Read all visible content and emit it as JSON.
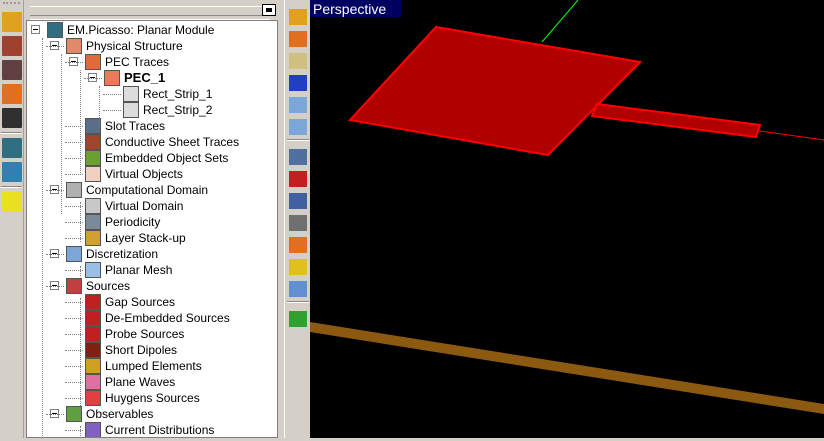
{
  "panel": {
    "maximize_label": ""
  },
  "tree": [
    {
      "label": "EM.Picasso: Planar Module",
      "level": 0,
      "expanded": true,
      "icon": "planar-module-icon",
      "color": "#2f6f7f"
    },
    {
      "label": "Physical Structure",
      "level": 1,
      "expanded": true,
      "icon": "physical-structure-icon",
      "color": "#e08a6a"
    },
    {
      "label": "PEC Traces",
      "level": 2,
      "expanded": true,
      "icon": "pec-traces-icon",
      "color": "#e06a3a"
    },
    {
      "label": "PEC_1",
      "level": 3,
      "expanded": true,
      "bold": true,
      "icon": "pec-group-icon",
      "color": "#e87a5a"
    },
    {
      "label": "Rect_Strip_1",
      "level": 4,
      "icon": "rect-strip-icon",
      "color": "#dcdcdc"
    },
    {
      "label": "Rect_Strip_2",
      "level": 4,
      "icon": "rect-strip-icon",
      "color": "#dcdcdc"
    },
    {
      "label": "Slot Traces",
      "level": 2,
      "icon": "slot-traces-icon",
      "color": "#5a6e8a"
    },
    {
      "label": "Conductive Sheet Traces",
      "level": 2,
      "icon": "conductive-sheet-icon",
      "color": "#a0442a"
    },
    {
      "label": "Embedded Object Sets",
      "level": 2,
      "icon": "embedded-objects-icon",
      "color": "#6aa030"
    },
    {
      "label": "Virtual Objects",
      "level": 2,
      "icon": "virtual-objects-icon",
      "color": "#f0d0c0"
    },
    {
      "label": "Computational Domain",
      "level": 1,
      "expanded": true,
      "icon": "computational-domain-icon",
      "color": "#b0b0b0"
    },
    {
      "label": "Virtual Domain",
      "level": 2,
      "icon": "virtual-domain-icon",
      "color": "#c8c8c8"
    },
    {
      "label": "Periodicity",
      "level": 2,
      "icon": "periodicity-icon",
      "color": "#7a8a9a"
    },
    {
      "label": "Layer Stack-up",
      "level": 2,
      "icon": "layer-stackup-icon",
      "color": "#d0a030"
    },
    {
      "label": "Discretization",
      "level": 1,
      "expanded": true,
      "icon": "discretization-icon",
      "color": "#7aa6d8"
    },
    {
      "label": "Planar Mesh",
      "level": 2,
      "icon": "planar-mesh-icon",
      "color": "#9ac0e8"
    },
    {
      "label": "Sources",
      "level": 1,
      "expanded": true,
      "icon": "sources-icon",
      "color": "#c04040"
    },
    {
      "label": "Gap Sources",
      "level": 2,
      "icon": "gap-source-icon",
      "color": "#c02020"
    },
    {
      "label": "De-Embedded Sources",
      "level": 2,
      "icon": "de-embedded-source-icon",
      "color": "#c02020"
    },
    {
      "label": "Probe Sources",
      "level": 2,
      "icon": "probe-source-icon",
      "color": "#c02020"
    },
    {
      "label": "Short Dipoles",
      "level": 2,
      "icon": "short-dipole-icon",
      "color": "#802010"
    },
    {
      "label": "Lumped Elements",
      "level": 2,
      "icon": "lumped-element-icon",
      "color": "#d0a020"
    },
    {
      "label": "Plane Waves",
      "level": 2,
      "icon": "plane-wave-icon",
      "color": "#e070a0"
    },
    {
      "label": "Huygens Sources",
      "level": 2,
      "icon": "huygens-source-icon",
      "color": "#e04040"
    },
    {
      "label": "Observables",
      "level": 1,
      "expanded": true,
      "icon": "observables-icon",
      "color": "#60a040"
    },
    {
      "label": "Current Distributions",
      "level": 2,
      "icon": "current-distribution-icon",
      "color": "#8060c0"
    }
  ],
  "left_toolbar": [
    {
      "icon": "cad-module-icon",
      "color": "#e0a020"
    },
    {
      "icon": "terrain-module-icon",
      "color": "#a04030"
    },
    {
      "icon": "wave-module-icon",
      "color": "#604040"
    },
    {
      "icon": "fdtd-module-icon",
      "color": "#e07020"
    },
    {
      "icon": "mom-module-icon",
      "color": "#303030"
    },
    {
      "icon": "planar-module-icon",
      "color": "#2f6f7f"
    },
    {
      "icon": "propagation-module-icon",
      "color": "#3080b0"
    },
    {
      "icon": "globe-icon",
      "color": "#e8e020"
    }
  ],
  "right_toolbar": [
    {
      "icon": "ruler-icon",
      "color": "#e0a020"
    },
    {
      "icon": "waveform-icon",
      "color": "#e07020"
    },
    {
      "icon": "materials-icon",
      "color": "#d0c080"
    },
    {
      "icon": "box-domain-icon",
      "color": "#2040c0"
    },
    {
      "icon": "mesh-grid-icon",
      "color": "#7aa6d8"
    },
    {
      "icon": "mesh-settings-icon",
      "color": "#7aa6d8"
    },
    {
      "icon": "function-icon",
      "color": "#5070a0"
    },
    {
      "icon": "excel-variables-icon",
      "color": "#c02020"
    },
    {
      "icon": "power-variable-icon",
      "color": "#4060a0"
    },
    {
      "icon": "graph-icon",
      "color": "#707070"
    },
    {
      "icon": "check-icon",
      "color": "#e07020"
    },
    {
      "icon": "plot-data-icon",
      "color": "#e0c020"
    },
    {
      "icon": "calculator-icon",
      "color": "#6090d0"
    },
    {
      "icon": "run-simulation-icon",
      "color": "#30a030"
    }
  ],
  "viewport": {
    "label": "Perspective",
    "trace_color": "#ff0000",
    "fill_color": "#b00000",
    "ground_color": "#8b5a10",
    "axis_color": "#00ff00"
  }
}
